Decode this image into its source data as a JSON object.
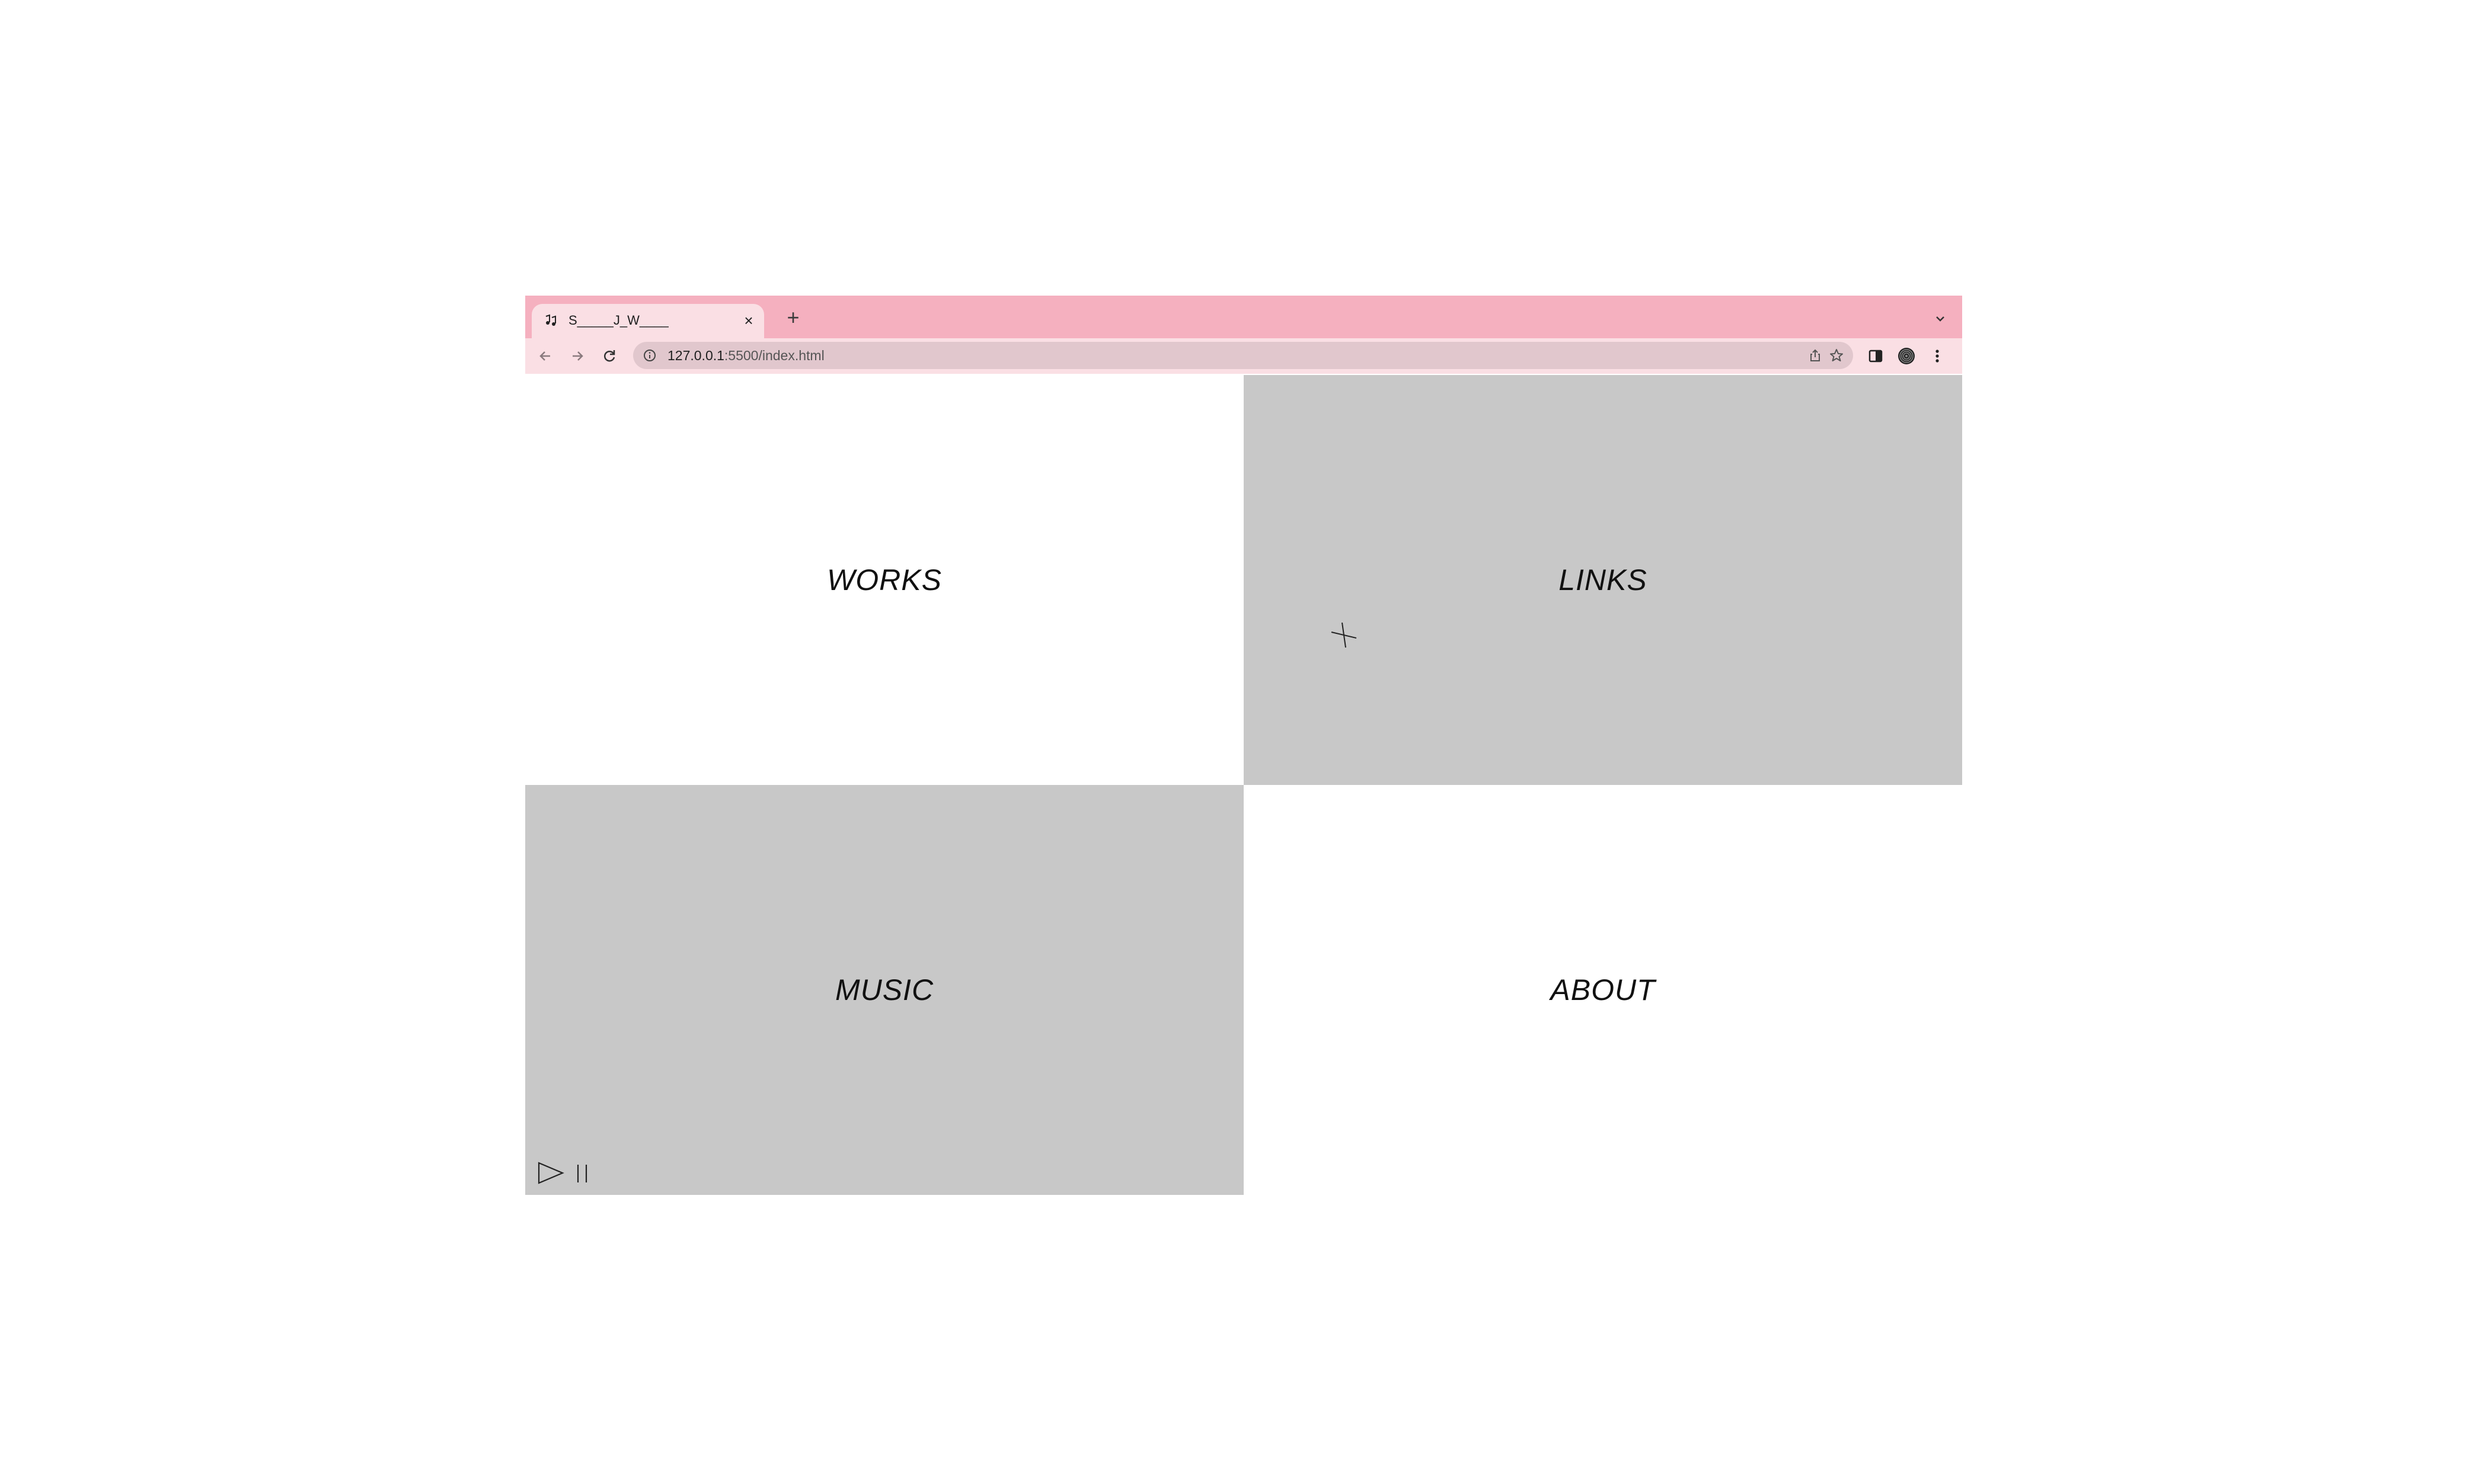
{
  "browser": {
    "tab": {
      "title": "S_____J_W____",
      "close": "×",
      "favicon": "music-note-icon"
    },
    "new_tab": "+",
    "toolbar": {
      "url_host": "127.0.0.1",
      "url_rest": ":5500/index.html",
      "icons": [
        "back-arrow-icon",
        "forward-arrow-icon",
        "reload-icon",
        "site-info-icon",
        "share-icon",
        "star-icon",
        "side-panel-icon",
        "profile-avatar-icon",
        "menu-kebab-icon"
      ]
    },
    "colors": {
      "tabstrip": "#f5b0bf",
      "toolbar": "#fadfe4",
      "omnibox": "#e1c7cd",
      "gray_panel": "#c8c8c8"
    }
  },
  "page": {
    "quadrants": {
      "works": "WORKS",
      "links": "LINKS",
      "music": "MUSIC",
      "about": "ABOUT"
    },
    "player": {
      "play": "play-icon",
      "pause": "pause-icon"
    }
  }
}
